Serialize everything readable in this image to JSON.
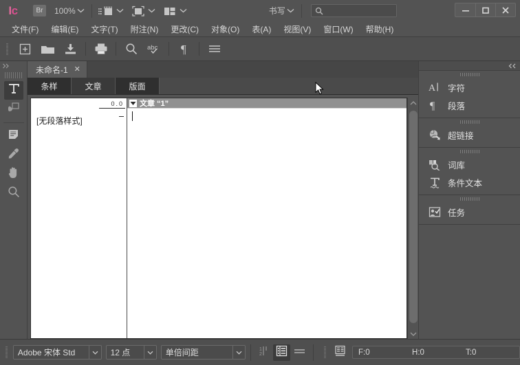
{
  "app": {
    "logo_text": "Ic",
    "bridge_badge": "Br",
    "zoom_level": "100%",
    "write_mode_label": "书写",
    "search_placeholder": ""
  },
  "window_controls": {
    "minimize": "minimize-icon",
    "maximize": "maximize-icon",
    "close": "close-icon"
  },
  "menubar": {
    "items": [
      {
        "label": "文件(F)"
      },
      {
        "label": "编辑(E)"
      },
      {
        "label": "文字(T)"
      },
      {
        "label": "附注(N)"
      },
      {
        "label": "更改(C)"
      },
      {
        "label": "对象(O)"
      },
      {
        "label": "表(A)"
      },
      {
        "label": "视图(V)"
      },
      {
        "label": "窗口(W)"
      },
      {
        "label": "帮助(H)"
      }
    ]
  },
  "toolstrip": {
    "buttons": [
      {
        "name": "new-document-icon"
      },
      {
        "name": "open-folder-icon"
      },
      {
        "name": "save-icon"
      },
      {
        "name": "print-icon"
      },
      {
        "name": "zoom-icon"
      },
      {
        "name": "spellcheck-icon"
      },
      {
        "name": "paragraph-mark-icon"
      },
      {
        "name": "menu-icon"
      }
    ]
  },
  "tools": {
    "items": [
      {
        "name": "type-tool",
        "icon": "text-tool-icon",
        "active": true
      },
      {
        "name": "note-tool",
        "icon": "note-tool-icon",
        "active": false
      },
      {
        "name": "story-tool",
        "icon": "document-text-icon",
        "active": false
      },
      {
        "name": "eyedropper-tool",
        "icon": "eyedropper-icon",
        "active": false
      },
      {
        "name": "hand-tool",
        "icon": "hand-icon",
        "active": false
      },
      {
        "name": "zoom-tool",
        "icon": "magnifier-icon",
        "active": false
      }
    ]
  },
  "document": {
    "tab_title": "未命名-1",
    "tab_close": "✕",
    "mode_tabs": [
      {
        "label": "条样",
        "selected": false
      },
      {
        "label": "文章",
        "selected": true
      },
      {
        "label": "版面",
        "selected": false
      }
    ],
    "style_column": {
      "ruler_value": "0.0",
      "paragraph_style": "[无段落样式]"
    },
    "story": {
      "header_label": "文章 “1”",
      "body_text": ""
    }
  },
  "right_dock": {
    "collapse_label": "◀◀",
    "groups": [
      {
        "items": [
          {
            "label": "字符",
            "icon": "character-panel-icon"
          },
          {
            "label": "段落",
            "icon": "paragraph-panel-icon"
          }
        ]
      },
      {
        "items": [
          {
            "label": "超链接",
            "icon": "hyperlink-panel-icon"
          }
        ]
      },
      {
        "items": [
          {
            "label": "词库",
            "icon": "thesaurus-panel-icon"
          },
          {
            "label": "条件文本",
            "icon": "conditional-text-icon"
          }
        ]
      },
      {
        "items": [
          {
            "label": "任务",
            "icon": "assignments-panel-icon"
          }
        ]
      }
    ]
  },
  "bottombar": {
    "font_family": "Adobe 宋体 Std",
    "font_size": "12 点",
    "leading": "单倍间距",
    "line_numbers_icon": "line-numbers-icon",
    "style_column_icon": "style-column-icon",
    "info_icon": "info-lines-icon",
    "doc_info_icon": "document-info-icon",
    "counters": {
      "f": "F:0",
      "h": "H:0",
      "t": "T:0"
    }
  },
  "colors": {
    "chrome": "#535353",
    "panel_dark": "#3b3b3b",
    "accent_logo": "#d94f8f",
    "text": "#e0e0e0",
    "story_header": "#909090"
  }
}
